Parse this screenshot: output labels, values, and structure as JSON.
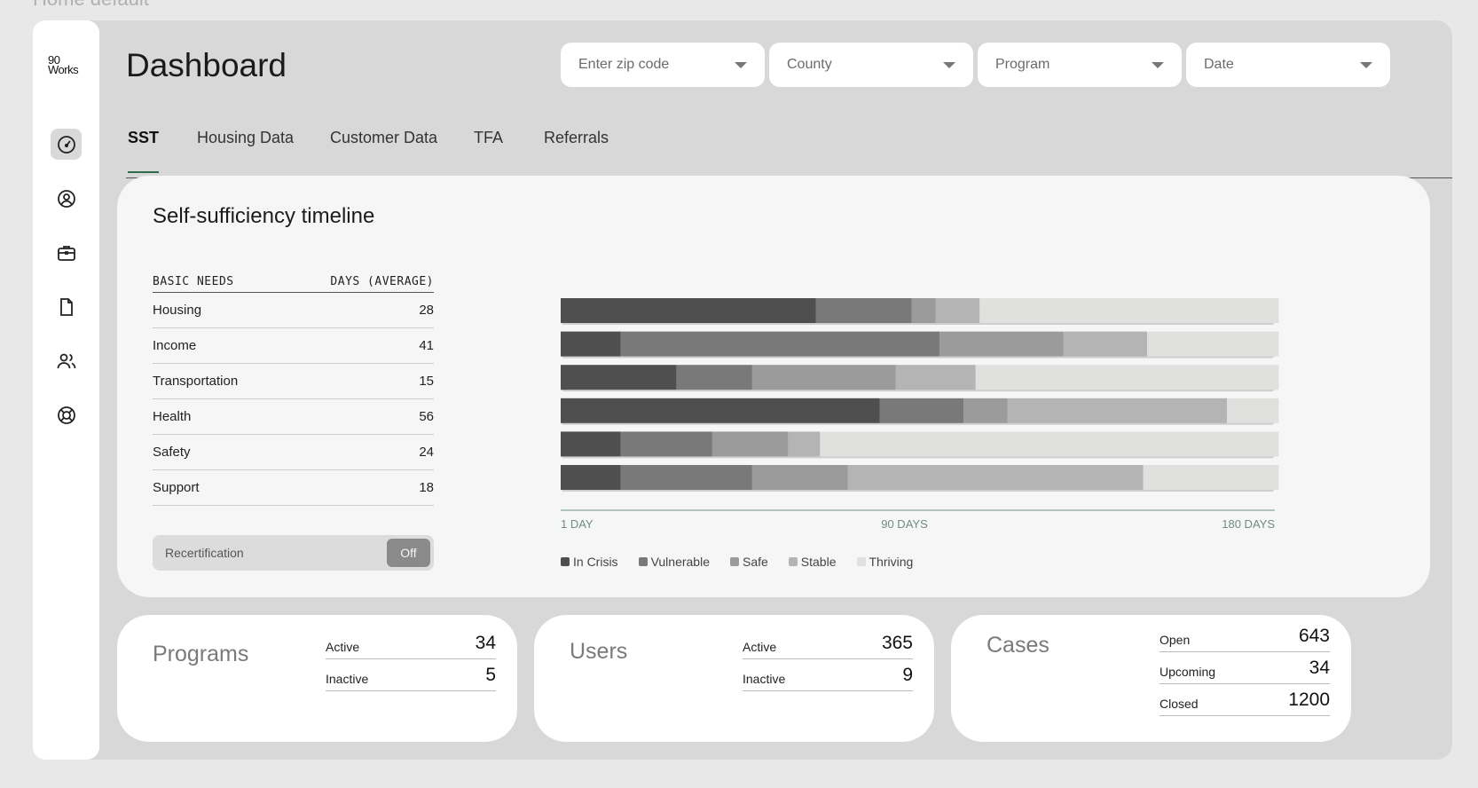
{
  "page_label": "Home default",
  "logo": {
    "line1": "90",
    "line2": "Works"
  },
  "header": {
    "title": "Dashboard"
  },
  "filters": [
    {
      "placeholder": "Enter zip code"
    },
    {
      "placeholder": "County"
    },
    {
      "placeholder": "Program"
    },
    {
      "placeholder": "Date"
    }
  ],
  "tabs": [
    {
      "label": "SST",
      "active": true
    },
    {
      "label": "Housing Data"
    },
    {
      "label": "Customer Data"
    },
    {
      "label": "TFA"
    },
    {
      "label": "Referrals"
    }
  ],
  "sidebar": {
    "icons": [
      "speedometer-icon",
      "user-circle-icon",
      "briefcase-icon",
      "document-icon",
      "users-icon",
      "lifebuoy-icon"
    ]
  },
  "sst": {
    "title": "Self-sufficiency timeline",
    "col_need": "BASIC NEEDS",
    "col_days": "DAYS (AVERAGE)",
    "rows": [
      {
        "need": "Housing",
        "days": "28"
      },
      {
        "need": "Income",
        "days": "41"
      },
      {
        "need": "Transportation",
        "days": "15"
      },
      {
        "need": "Health",
        "days": "56"
      },
      {
        "need": "Safety",
        "days": "24"
      },
      {
        "need": "Support",
        "days": "18"
      }
    ],
    "toggle_label": "Recertification",
    "toggle_value": "Off"
  },
  "chart_data": {
    "type": "bar",
    "orientation": "horizontal",
    "stacked": true,
    "categories": [
      "Housing",
      "Income",
      "Transportation",
      "Health",
      "Safety",
      "Support"
    ],
    "x_ticks": [
      "1 DAY",
      "90 DAYS",
      "180 DAYS"
    ],
    "xlim": [
      1,
      180
    ],
    "series": [
      {
        "name": "In Crisis",
        "color": "#4f4f4f",
        "values": [
          64,
          15,
          29,
          80,
          15,
          15
        ]
      },
      {
        "name": "Vulnerable",
        "color": "#797979",
        "values": [
          24,
          80,
          19,
          21,
          23,
          33
        ]
      },
      {
        "name": "Safe",
        "color": "#9b9b9b",
        "values": [
          6,
          31,
          36,
          11,
          19,
          24
        ]
      },
      {
        "name": "Stable",
        "color": "#b4b4b4",
        "values": [
          11,
          21,
          20,
          55,
          8,
          74
        ]
      },
      {
        "name": "Thriving",
        "color": "#e0e0de",
        "values": [
          75,
          33,
          76,
          13,
          115,
          34
        ]
      }
    ]
  },
  "stats": {
    "programs": {
      "title": "Programs",
      "rows": [
        {
          "label": "Active",
          "value": "34"
        },
        {
          "label": "Inactive",
          "value": "5"
        }
      ]
    },
    "users": {
      "title": "Users",
      "rows": [
        {
          "label": "Active",
          "value": "365"
        },
        {
          "label": "Inactive",
          "value": "9"
        }
      ]
    },
    "cases": {
      "title": "Cases",
      "rows": [
        {
          "label": "Open",
          "value": "643"
        },
        {
          "label": "Upcoming",
          "value": "34"
        },
        {
          "label": "Closed",
          "value": "1200"
        }
      ]
    }
  }
}
